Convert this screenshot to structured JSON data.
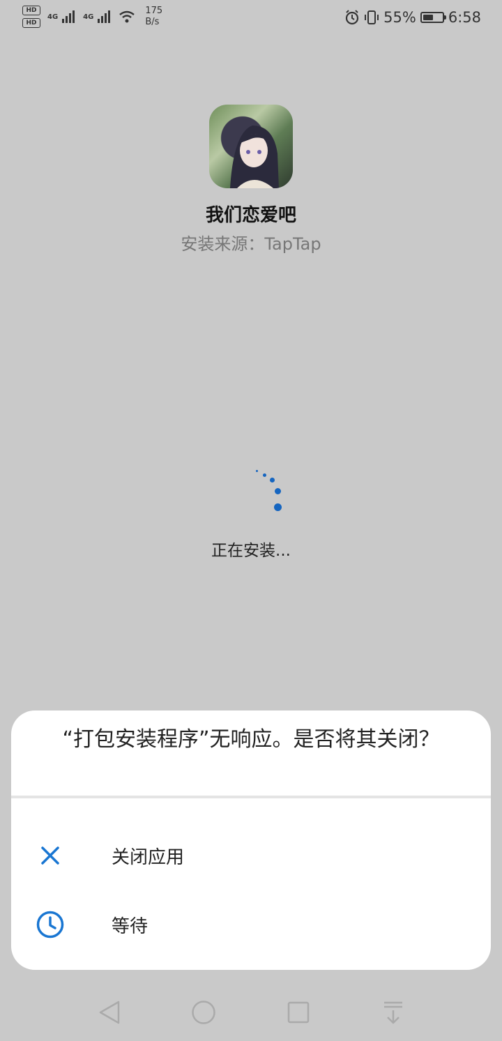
{
  "status_bar": {
    "hd1": "HD",
    "hd2": "HD",
    "sig1": "4G",
    "sig2": "4G",
    "speed_value": "175",
    "speed_unit": "B/s",
    "battery_percent": "55%",
    "battery_level": 0.55,
    "time": "6:58",
    "icons": [
      "alarm-icon",
      "vibrate-icon",
      "wifi-icon",
      "signal-icon"
    ]
  },
  "app": {
    "name": "我们恋爱吧",
    "source": "安装来源：TapTap"
  },
  "install_status": "正在安装...",
  "dialog": {
    "title": "“打包安装程序”无响应。是否将其关闭？",
    "options": [
      {
        "label": "关闭应用",
        "icon": "close-icon"
      },
      {
        "label": "等待",
        "icon": "clock-icon"
      }
    ]
  },
  "navbar": {
    "icons": [
      "back-icon",
      "home-icon",
      "recents-icon",
      "notification-pull-icon"
    ]
  },
  "colors": {
    "accent": "#1976d2",
    "background": "#c9c9c9",
    "dialog": "#ffffff"
  }
}
